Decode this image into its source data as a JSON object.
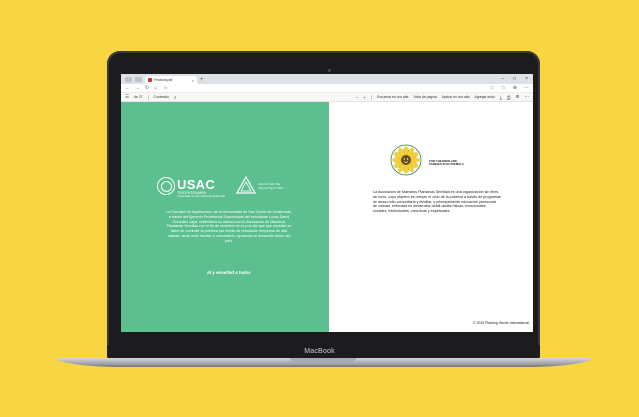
{
  "device": {
    "label": "MacBook"
  },
  "browser": {
    "tab_title": "Festival.pdf",
    "tab_close": "×",
    "new_tab": "+",
    "window_controls": [
      "–",
      "□",
      "×"
    ],
    "url": "⊙",
    "nav_icons": [
      "←",
      "→",
      "↻",
      "⌂"
    ],
    "address_icons": [
      "☆",
      "☆",
      "⊕",
      "⋯"
    ]
  },
  "pdf_toolbar": {
    "page_indicator": "de 27",
    "contents_label": "Contenido",
    "search_icon": "⌕",
    "zoom_out": "−",
    "zoom_in": "+",
    "read_aloud": "Escuchar en voz alta",
    "page_view": "Vista de página",
    "text_options": "Aplicar en voz alta",
    "add_text": "Agregar texto",
    "right_icons": [
      "⤓",
      "⎙",
      "⚙",
      "⋯"
    ]
  },
  "left_page": {
    "logo_usac": "USAC",
    "logo_usac_sub1": "TRICENTENARIA",
    "logo_usac_sub2": "Universidad de San Carlos de Guatemala",
    "logo_arq": "FACULTAD DE\nARQUITECTURA",
    "paragraph": "La Facultad de Arquitectura, de la Universidad de San Carlos de Guatemala, a través del Ejercicio Profesional Supervisado del estudiante Lucas David González Jaya, materializa su alianza con la Asociación de Maestros Plantando Semillas con el fin de contribuir en la pue-sta que que consiste su labor de combatir la pobreza por medio de educación temprana de alta calidad, desa-rrollo familiar y comunitario, ayudando al desarrollo futuro del país.",
    "tagline": "Id y enseñad a todos"
  },
  "right_page": {
    "logo_caption": "FOR CHILDREN AND\nFAMILIES IN GUATEMALA",
    "paragraph": "La Asociación de Maestros Plantando Semillas es una organización sin fines de lucro, cuyo objetivo es romper el ciclo de la pobreza a través de programas de desa-rrollo comunitario y familiar, y principalmente educación preescolar de calidad, enfocada en desarrollar habili-dades físicas, emocionales, sociales, intelectuales, crea-tivas y espirituales.",
    "copyright": "© 2020 Planting Seeds International"
  },
  "colors": {
    "background": "#f9d541",
    "left_page": "#5bbf8f",
    "sunflower_petals": "#f4d23c"
  }
}
